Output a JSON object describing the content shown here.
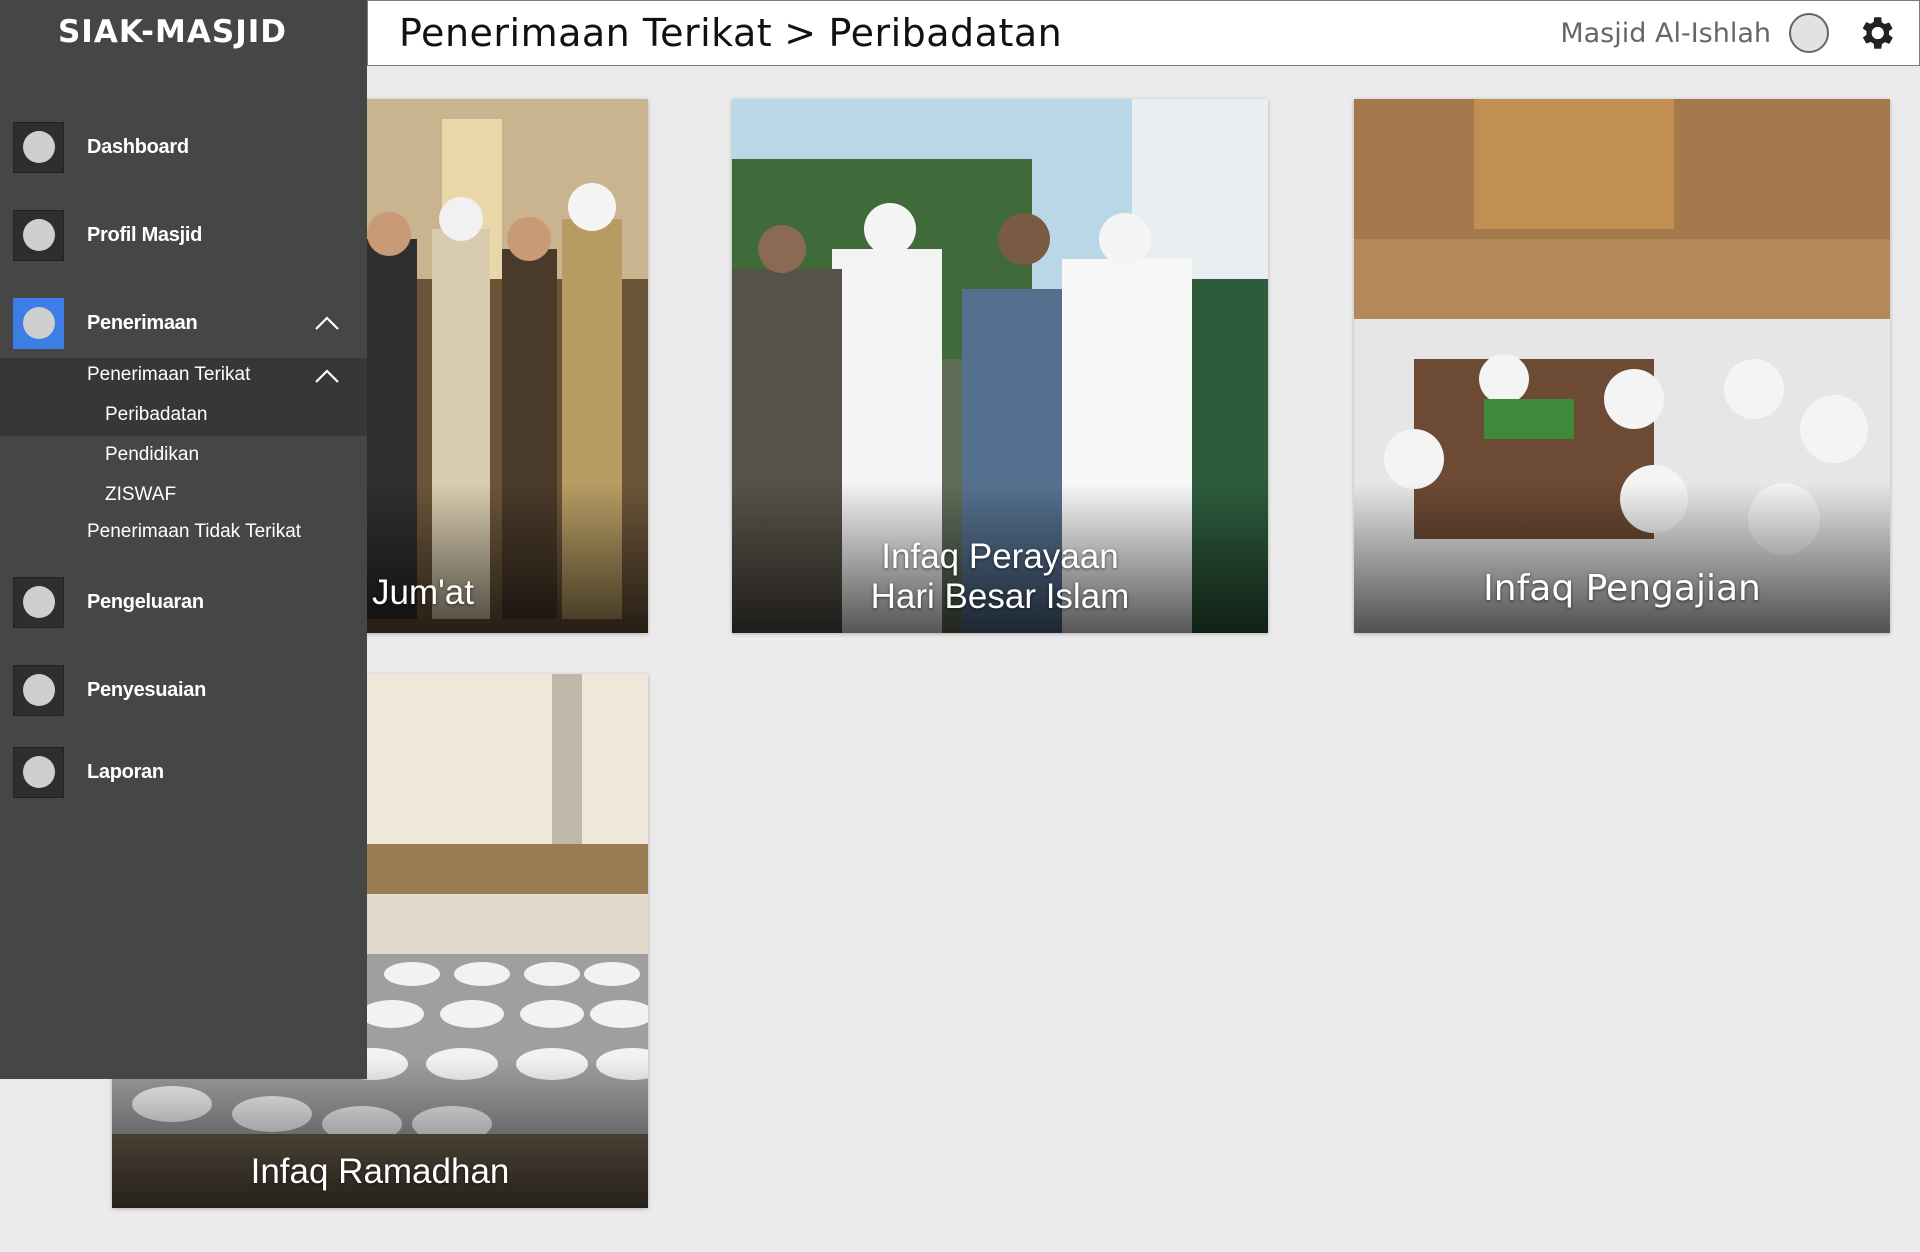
{
  "app": {
    "title": "SIAK-MASJID"
  },
  "header": {
    "breadcrumb_parent": "Penerimaan Terikat",
    "breadcrumb_separator": ">",
    "breadcrumb_current": "Peribadatan",
    "mosque_name": "Masjid Al-Ishlah"
  },
  "sidebar": {
    "items": [
      {
        "label": "Dashboard"
      },
      {
        "label": "Profil Masjid"
      },
      {
        "label": "Penerimaan"
      },
      {
        "label": "Pengeluaran"
      },
      {
        "label": "Penyesuaian"
      },
      {
        "label": "Laporan"
      }
    ],
    "submenu": {
      "penerimaan_terikat": "Penerimaan Terikat",
      "children": [
        "Peribadatan",
        "Pendidikan",
        "ZISWAF"
      ],
      "penerimaan_tidak_terikat": "Penerimaan Tidak Terikat"
    }
  },
  "cards": [
    {
      "caption": "Jum'at"
    },
    {
      "caption_line1": "Infaq Perayaan",
      "caption_line2": "Hari Besar Islam"
    },
    {
      "caption": "Infaq Pengajian"
    },
    {
      "caption": "Infaq Ramadhan"
    }
  ],
  "colors": {
    "sidebar": "#464646",
    "active": "#3d7ee6",
    "background": "#ebebeb"
  }
}
